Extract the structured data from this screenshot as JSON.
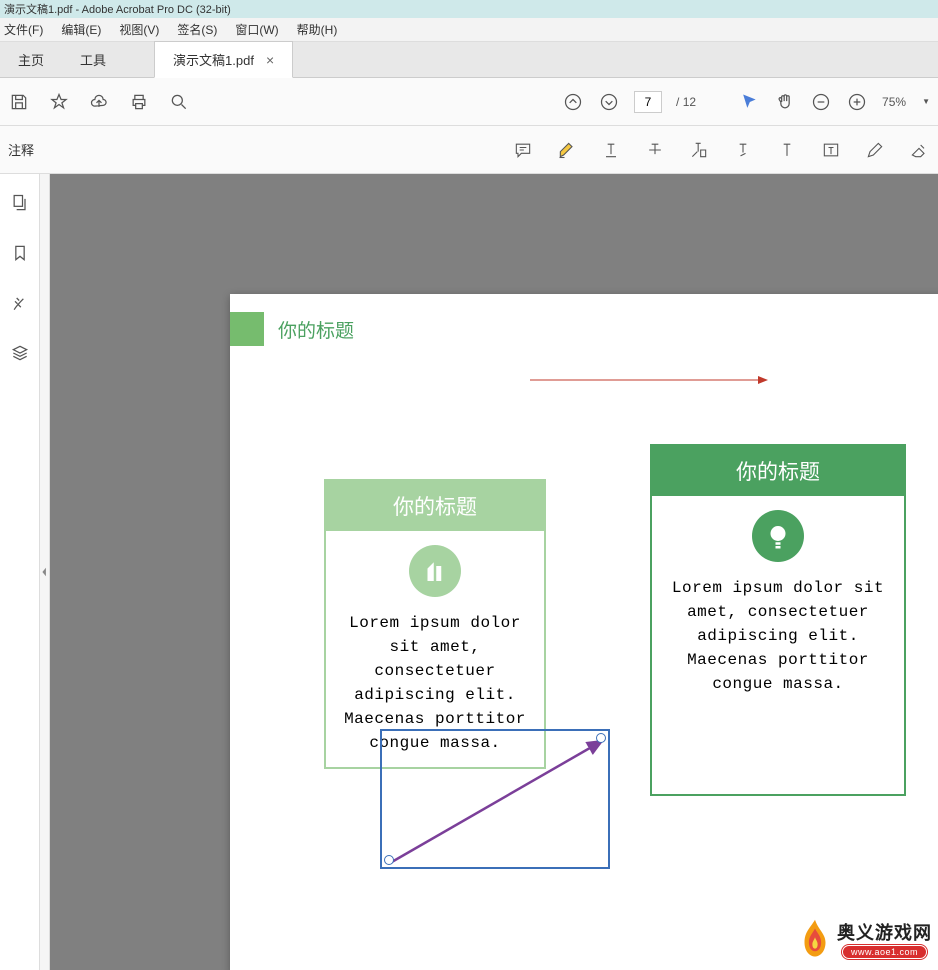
{
  "titlebar": "演示文稿1.pdf - Adobe Acrobat Pro DC (32-bit)",
  "menu": {
    "file": "文件(F)",
    "edit": "编辑(E)",
    "view": "视图(V)",
    "sign": "签名(S)",
    "window": "窗口(W)",
    "help": "帮助(H)"
  },
  "tabs": {
    "home": "主页",
    "tools": "工具",
    "doc": "演示文稿1.pdf",
    "close": "×"
  },
  "page": {
    "current": "7",
    "sep": "/",
    "total": "12"
  },
  "zoom": {
    "value": "75%"
  },
  "ann": {
    "label": "注释"
  },
  "doc": {
    "heading": "你的标题",
    "card1": {
      "title": "你的标题",
      "body": "Lorem ipsum dolor sit amet, consectetuer adipiscing elit. Maecenas porttitor congue massa."
    },
    "card2": {
      "title": "你的标题",
      "body": "Lorem ipsum dolor sit amet, consectetuer adipiscing elit. Maecenas porttitor congue massa."
    }
  },
  "watermark": {
    "cn": "奥义游戏网",
    "url": "www.aoe1.com"
  }
}
